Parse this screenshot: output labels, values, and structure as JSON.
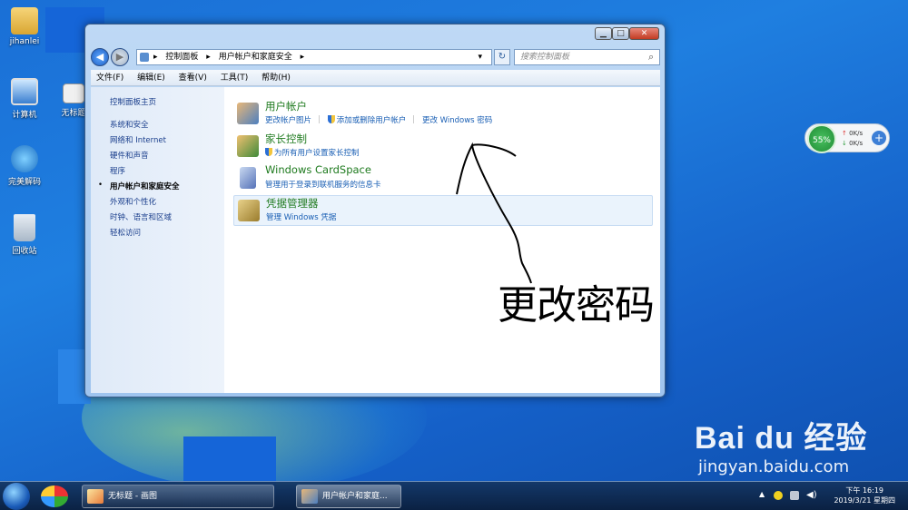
{
  "desktop": {
    "icons": [
      {
        "label": "jihanlei"
      },
      {
        "label": "计算机"
      },
      {
        "label": "无标题"
      },
      {
        "label": "完美解码"
      },
      {
        "label": "回收站"
      }
    ]
  },
  "window": {
    "breadcrumb": [
      "控制面板",
      "用户帐户和家庭安全"
    ],
    "search_placeholder": "搜索控制面板",
    "menu": [
      "文件(F)",
      "编辑(E)",
      "查看(V)",
      "工具(T)",
      "帮助(H)"
    ],
    "sidebar": {
      "home": "控制面板主页",
      "items": [
        "系统和安全",
        "网络和 Internet",
        "硬件和声音",
        "程序",
        "用户帐户和家庭安全",
        "外观和个性化",
        "时钟、语言和区域",
        "轻松访问"
      ],
      "active_index": 4
    },
    "categories": [
      {
        "title": "用户帐户",
        "icon": "users-icon",
        "links": [
          "更改帐户图片",
          "添加或删除用户帐户",
          "更改 Windows 密码"
        ]
      },
      {
        "title": "家长控制",
        "icon": "parental-control-icon",
        "links": [
          "为所有用户设置家长控制"
        ]
      },
      {
        "title": "Windows CardSpace",
        "icon": "cardspace-icon",
        "links": [
          "管理用于登录到联机服务的信息卡"
        ]
      },
      {
        "title": "凭据管理器",
        "icon": "credential-manager-icon",
        "links": [
          "管理 Windows 凭据"
        ]
      }
    ]
  },
  "annotation": {
    "text": "更改密码"
  },
  "net_widget": {
    "percent": "55%",
    "up": "0K/s",
    "down": "0K/s"
  },
  "taskbar": {
    "buttons": [
      "无标题 - 画图",
      "用户帐户和家庭..."
    ],
    "time": "下午 16:19",
    "date": "2019/3/21 星期四"
  },
  "watermark": {
    "brand": "Bai du 经验",
    "url": "jingyan.baidu.com"
  },
  "colors": {
    "link": "#1a5fb4",
    "category_title": "#1e7a1e",
    "desktop": "#1a6fd6"
  }
}
